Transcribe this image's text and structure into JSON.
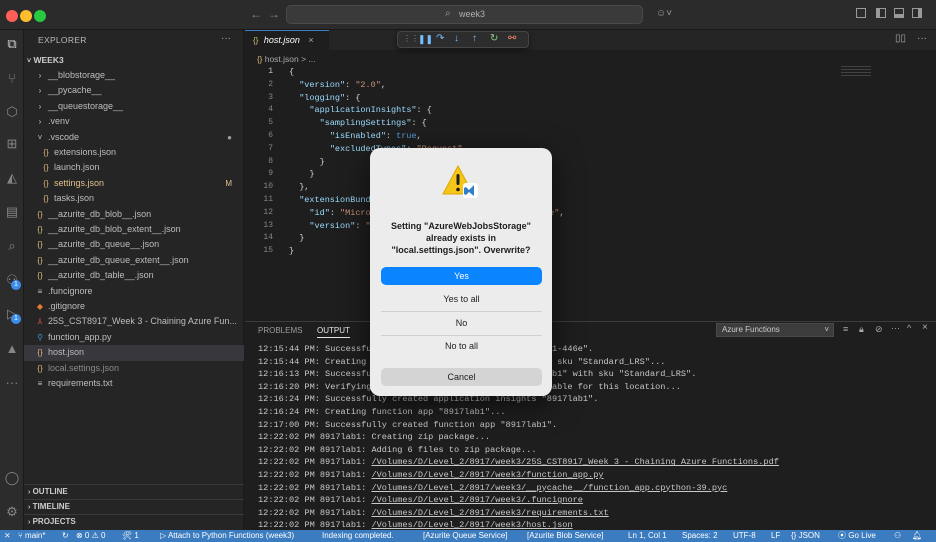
{
  "titlebar": {
    "search_text": "week3",
    "back_arrow": "←",
    "forward_arrow": "→"
  },
  "sidebar": {
    "header": "EXPLORER",
    "folder": "WEEK3",
    "items": [
      {
        "label": "__blobstorage__",
        "kind": "folder",
        "indent": 1
      },
      {
        "label": "__pycache__",
        "kind": "folder",
        "indent": 1
      },
      {
        "label": "__queuestorage__",
        "kind": "folder",
        "indent": 1
      },
      {
        "label": ".venv",
        "kind": "folder",
        "indent": 1
      },
      {
        "label": ".vscode",
        "kind": "folder-open",
        "indent": 1,
        "mark": "●"
      },
      {
        "label": "extensions.json",
        "kind": "json",
        "indent": 2
      },
      {
        "label": "launch.json",
        "kind": "json",
        "indent": 2
      },
      {
        "label": "settings.json",
        "kind": "json",
        "indent": 2,
        "mark": "M"
      },
      {
        "label": "tasks.json",
        "kind": "json",
        "indent": 2
      },
      {
        "label": "__azurite_db_blob__.json",
        "kind": "json",
        "indent": 1
      },
      {
        "label": "__azurite_db_blob_extent__.json",
        "kind": "json",
        "indent": 1
      },
      {
        "label": "__azurite_db_queue__.json",
        "kind": "json",
        "indent": 1
      },
      {
        "label": "__azurite_db_queue_extent__.json",
        "kind": "json",
        "indent": 1
      },
      {
        "label": "__azurite_db_table__.json",
        "kind": "json",
        "indent": 1
      },
      {
        "label": ".funcignore",
        "kind": "text",
        "indent": 1
      },
      {
        "label": ".gitignore",
        "kind": "git",
        "indent": 1
      },
      {
        "label": "25S_CST8917_Week 3 - Chaining Azure Fun...",
        "kind": "pdf",
        "indent": 1
      },
      {
        "label": "function_app.py",
        "kind": "py",
        "indent": 1
      },
      {
        "label": "host.json",
        "kind": "json",
        "indent": 1,
        "selected": true
      },
      {
        "label": "local.settings.json",
        "kind": "json",
        "indent": 1,
        "dim": true
      },
      {
        "label": "requirements.txt",
        "kind": "text",
        "indent": 1
      }
    ],
    "outline": "OUTLINE",
    "timeline": "TIMELINE",
    "projects": "PROJECTS"
  },
  "editor": {
    "tab_label": "host.json",
    "tab_icon": "{}",
    "breadcrumb": "host.json > ...",
    "lines": [
      {
        "n": "1",
        "t": "{"
      },
      {
        "n": "2",
        "t": "  \"version\": \"2.0\","
      },
      {
        "n": "3",
        "t": "  \"logging\": {"
      },
      {
        "n": "4",
        "t": "    \"applicationInsights\": {"
      },
      {
        "n": "5",
        "t": "      \"samplingSettings\": {"
      },
      {
        "n": "6",
        "t": "        \"isEnabled\": true,"
      },
      {
        "n": "7",
        "t": "        \"excludedTypes\": \"Request\""
      },
      {
        "n": "8",
        "t": "      }"
      },
      {
        "n": "9",
        "t": "    }"
      },
      {
        "n": "10",
        "t": "  },"
      },
      {
        "n": "11",
        "t": "  \"extensionBundle\": {"
      },
      {
        "n": "12",
        "t": "    \"id\": \"Microsoft.Azure.Functions.ExtensionBundle\","
      },
      {
        "n": "13",
        "t": "    \"version\": \"[4.*, 5.0.0)\""
      },
      {
        "n": "14",
        "t": "  }"
      },
      {
        "n": "15",
        "t": "}"
      }
    ]
  },
  "panel": {
    "tabs": [
      "PROBLEMS",
      "OUTPUT"
    ],
    "active_tab": "OUTPUT",
    "dropdown_value": "Azure Functions",
    "output": [
      "12:15:44 PM: Successfully created resource group \"8917lab1-446e\".",
      "12:15:44 PM: Creating new storage account \"8917lab1\" with sku \"Standard_LRS\"...",
      "12:16:13 PM: Successfully created storage account \"8917lab1\" with sku \"Standard_LRS\".",
      "12:16:20 PM: Verifying that Application Insights is available for this location...",
      "12:16:24 PM: Successfully created application insights \"8917lab1\".",
      "12:16:24 PM: Creating function app \"8917lab1\"...",
      "12:17:00 PM: Successfully created function app \"8917lab1\".",
      "12:22:02 PM 8917lab1: Creating zip package...",
      "12:22:02 PM 8917lab1: Adding 6 files to zip package...",
      "12:22:02 PM 8917lab1: /Volumes/D/Level_2/8917/week3/25S_CST8917_Week 3 - Chaining Azure Functions.pdf",
      "12:22:02 PM 8917lab1: /Volumes/D/Level_2/8917/week3/function_app.py",
      "12:22:02 PM 8917lab1: /Volumes/D/Level_2/8917/week3/__pycache__/function_app.cpython-39.pyc",
      "12:22:02 PM 8917lab1: /Volumes/D/Level_2/8917/week3/.funcignore",
      "12:22:02 PM 8917lab1: /Volumes/D/Level_2/8917/week3/requirements.txt",
      "12:22:02 PM 8917lab1: /Volumes/D/Level_2/8917/week3/host.json"
    ]
  },
  "dialog": {
    "message": "Setting \"AzureWebJobsStorage\" already exists in \"local.settings.json\". Overwrite?",
    "message_l1": "Setting \"AzureWebJobsStorage\"",
    "message_l2": "already exists in",
    "message_l3": "\"local.settings.json\". Overwrite?",
    "yes": "Yes",
    "yes_to_all": "Yes to all",
    "no": "No",
    "no_to_all": "No to all",
    "cancel": "Cancel"
  },
  "statusbar": {
    "branch": "main*",
    "sync": "⊗ 0 ⚠ 0",
    "ports": "🛠 1",
    "attach": "Attach to Python Functions (week3)",
    "indexing": "Indexing completed.",
    "queue": "[Azurite Queue Service]",
    "blob": "[Azurite Blob Service]",
    "position": "Ln 1, Col 1",
    "spaces": "Spaces: 2",
    "encoding": "UTF-8",
    "eol": "LF",
    "language": "JSON",
    "golive": "Go Live"
  },
  "colors": {
    "accent": "#0a84ff",
    "status_bar": "#3b7bbf"
  }
}
